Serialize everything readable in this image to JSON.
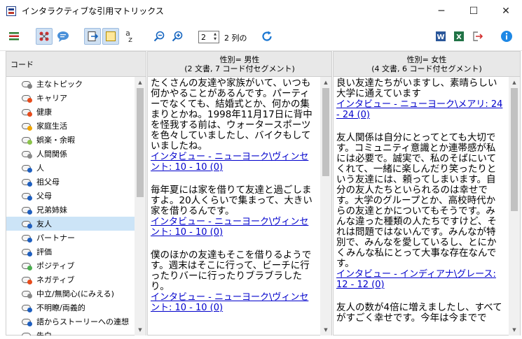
{
  "window": {
    "title": "インタラクティブな引用マトリックス",
    "minimize": "─",
    "maximize": "☐",
    "close": "✕"
  },
  "toolbar": {
    "spin_value": "2",
    "spin_label": "2 列の",
    "az_label": "a",
    "az_sub": "z"
  },
  "codes_panel": {
    "header": "コード",
    "items": [
      {
        "label": "主なトピック",
        "color": "#7f7f7f"
      },
      {
        "label": "キャリア",
        "color": "#e74c1c"
      },
      {
        "label": "健康",
        "color": "#e74c1c"
      },
      {
        "label": "家庭生活",
        "color": "#f0a500"
      },
      {
        "label": "娯楽・余暇",
        "color": "#8bc34a"
      },
      {
        "label": "人間関係",
        "color": "#8a8a8a"
      },
      {
        "label": "人",
        "color": "#1f5fbf"
      },
      {
        "label": "祖父母",
        "color": "#1f5fbf"
      },
      {
        "label": "父母",
        "color": "#1f5fbf"
      },
      {
        "label": "兄弟姉妹",
        "color": "#1f5fbf"
      },
      {
        "label": "友人",
        "color": "#1f5fbf",
        "selected": true
      },
      {
        "label": "パートナー",
        "color": "#1f5fbf"
      },
      {
        "label": "評価",
        "color": "#1f5fbf"
      },
      {
        "label": "ポジティブ",
        "color": "#4caf50"
      },
      {
        "label": "ネガティブ",
        "color": "#e74c1c"
      },
      {
        "label": "中立/無関心(にみえる)",
        "color": "#888888"
      },
      {
        "label": "不明瞭/両義的",
        "color": "#1f5fbf"
      },
      {
        "label": "語からストーリーへの連想",
        "color": "#1f5fbf"
      },
      {
        "label": "告白",
        "color": "#1f5fbf"
      }
    ]
  },
  "columns": [
    {
      "header_line1": "性別= 男性",
      "header_line2": "(2 文書, 7 コード付セグメント)",
      "segments": [
        {
          "text": "たくさんの友達や家族がいて、いつも何かやることがあるんです。パーティーでなくても、結婚式とか、何かの集まりとかね。1998年11月17日に背中を怪我する前は、ウォータースポーツを色々していましたし、バイクもしていましたね。",
          "link": "インタビュー - ニューヨーク\\ヴィンセント: 10 - 10 (0)"
        },
        {
          "text": "毎年夏には家を借りて友達と過ごしますよ。20人くらいで集まって、大きい家を借りるんです。",
          "link": "インタビュー - ニューヨーク\\ヴィンセント: 10 - 10 (0)"
        },
        {
          "text": "僕のほかの友達もそこを借りるようです。週末はそこに行って、ビーチに行ったりバーに行ったりブラブラしたり。",
          "link": "インタビュー - ニューヨーク\\ヴィンセント: 10 - 10 (0)"
        }
      ]
    },
    {
      "header_line1": "性別= 女性",
      "header_line2": "(4 文書, 6 コード付セグメント)",
      "segments": [
        {
          "text": "良い友達たちがいますし、素晴らしい大学に通えています",
          "link": "インタビュー - ニューヨーク\\メアリ: 24 - 24 (0)"
        },
        {
          "text": "友人関係は自分にとってとても大切です。コミュニティ意識とか連帯感が私には必要で。誠実で、私のそばにいてくれて、一緒に楽しんだり笑ったりという友達には、頼ってしまいます。自分の友人たちといられるのは幸せです。大学のグループとか、高校時代からの友達とかについてもそうです。みんな違った種類の人たちですけど、それは問題ではないんです。みんなが特別で、みんなを愛しているし、とにかくみんな私にとって大事な存在なんです。",
          "link": "インタビュー - インディアナ\\グレース: 12 - 12 (0)"
        },
        {
          "text": "友人の数が4倍に増えましたし、すべてがすごく幸せです。今年は今までで",
          "link": ""
        }
      ]
    }
  ],
  "colors": {
    "link": "#0000cc",
    "selection": "#cce4f7",
    "header_bg": "#e8e8e8"
  }
}
